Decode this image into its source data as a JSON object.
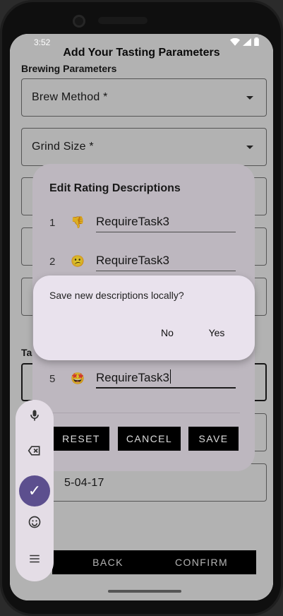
{
  "status_bar": {
    "time": "3:52",
    "icons": [
      "wifi-icon",
      "signal-icon",
      "battery-icon"
    ]
  },
  "page": {
    "title": "Add Your Tasting Parameters",
    "section_brewing": "Brewing Parameters",
    "brew_method": "Brew Method *",
    "grind_size": "Grind Size *",
    "section_tasting": "Tas",
    "date_value": "5-04-17",
    "back_label": "BACK",
    "confirm_label": "CONFIRM"
  },
  "dialog": {
    "title": "Edit Rating Descriptions",
    "rows": [
      {
        "num": "1",
        "emoji": "👎",
        "value": "RequireTask3"
      },
      {
        "num": "2",
        "emoji": "😕",
        "value": "RequireTask3"
      },
      {
        "num": "5",
        "emoji": "🤩",
        "value": "RequireTask3"
      }
    ],
    "reset_label": "RESET",
    "cancel_label": "CANCEL",
    "save_label": "SAVE"
  },
  "confirm": {
    "message": "Save new descriptions locally?",
    "no_label": "No",
    "yes_label": "Yes"
  },
  "keyboard_toolbar": {
    "icons": [
      "mic-icon",
      "backspace-icon",
      "check-icon",
      "emoji-icon",
      "menu-icon"
    ],
    "accent": "#5c4f8e"
  }
}
